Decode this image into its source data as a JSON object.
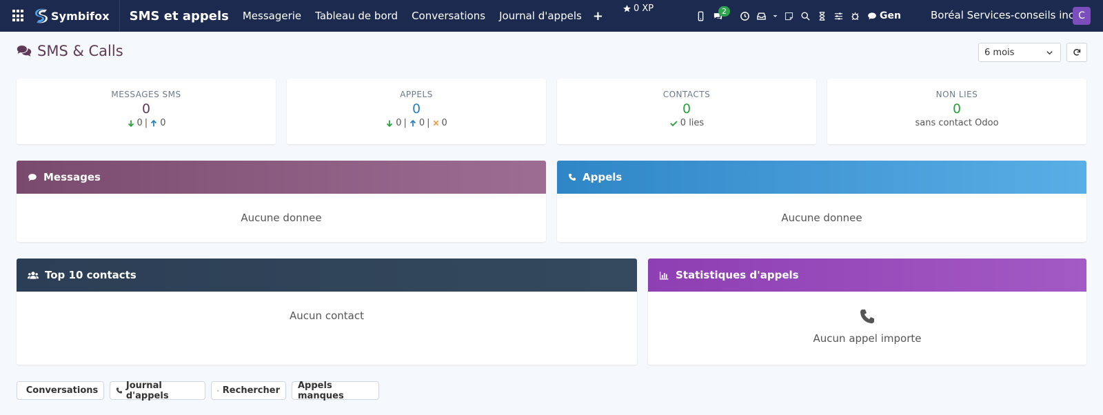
{
  "navbar": {
    "brand": "Symbifox",
    "app_title": "SMS et appels",
    "menu": [
      "Messagerie",
      "Tableau de bord",
      "Conversations",
      "Journal d'appels"
    ],
    "xp": "0 XP",
    "chat_badge": "2",
    "gen_label": "Gen",
    "company": "Boréal Services-conseils inc.",
    "avatar_initial": "C"
  },
  "header": {
    "title": "SMS & Calls",
    "period": "6 mois"
  },
  "stats": {
    "sms": {
      "label": "MESSAGES SMS",
      "value": "0",
      "in": "0",
      "out": "0"
    },
    "calls": {
      "label": "APPELS",
      "value": "0",
      "in": "0",
      "out": "0",
      "missed": "0"
    },
    "contacts": {
      "label": "CONTACTS",
      "value": "0",
      "sub": "0 lies"
    },
    "unlinked": {
      "label": "NON LIES",
      "value": "0",
      "sub": "sans contact Odoo"
    }
  },
  "panels": {
    "messages": {
      "title": "Messages",
      "empty": "Aucune donnee"
    },
    "calls": {
      "title": "Appels",
      "empty": "Aucune donnee"
    },
    "top_contacts": {
      "title": "Top 10 contacts",
      "empty": "Aucun contact"
    },
    "call_stats": {
      "title": "Statistiques d'appels",
      "empty": "Aucun appel importe"
    }
  },
  "buttons": {
    "conversations": "Conversations",
    "call_log": "Journal d'appels",
    "search": "Rechercher",
    "missed_calls": "Appels manques"
  },
  "colors": {
    "navbar": "#1b2a4e",
    "sms_value": "#5e3a57",
    "calls_value": "#2a7fc1",
    "green": "#28a03c",
    "messages_head_start": "#7a4a6e",
    "calls_head_start": "#2f86c6",
    "contacts_head": "#2c3e55",
    "stats_head": "#9346b8"
  }
}
